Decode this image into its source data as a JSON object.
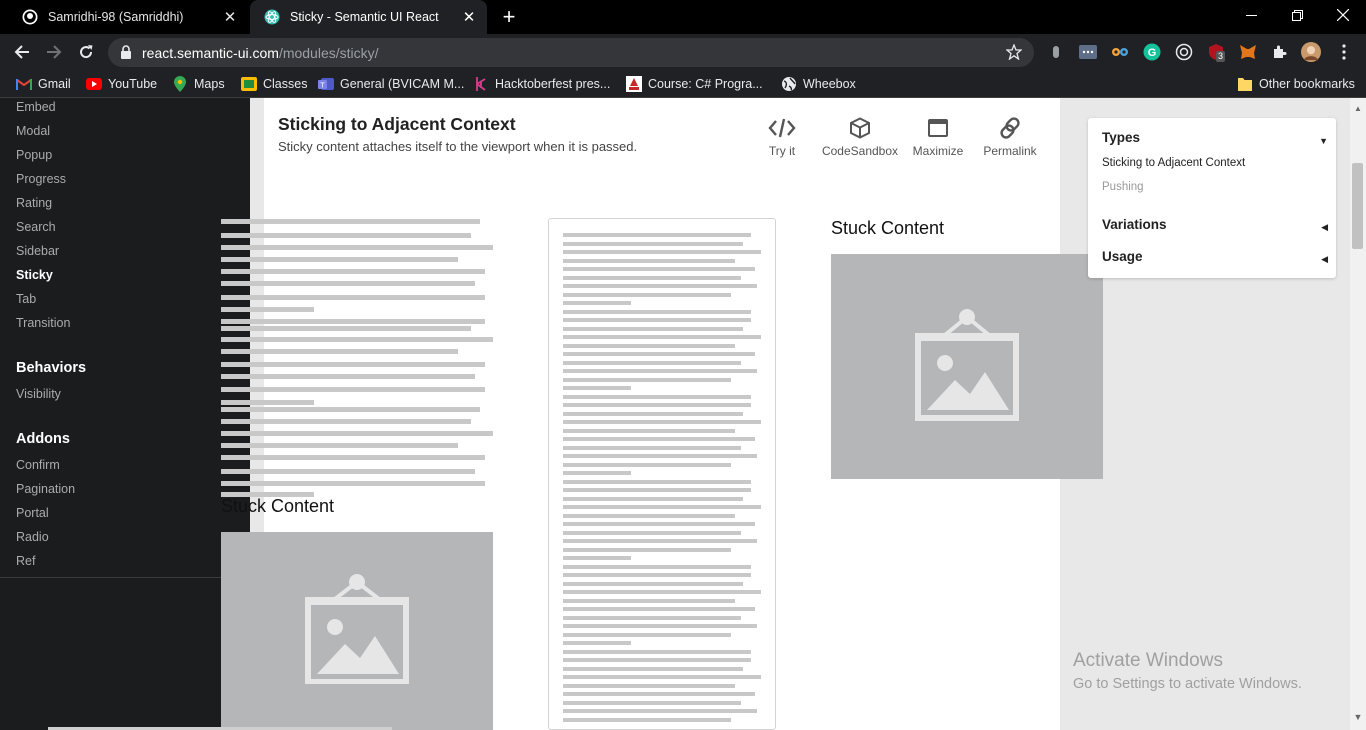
{
  "browser": {
    "tabs": [
      {
        "title": "Samridhi-98 (Samriddhi)",
        "active": false
      },
      {
        "title": "Sticky - Semantic UI React",
        "active": true
      }
    ],
    "url": {
      "host": "react.semantic-ui.com",
      "path": "/modules/sticky/"
    },
    "bookmarks": [
      {
        "label": "Gmail",
        "icon": "gmail-icon"
      },
      {
        "label": "YouTube",
        "icon": "youtube-icon"
      },
      {
        "label": "Maps",
        "icon": "maps-icon"
      },
      {
        "label": "Classes",
        "icon": "classes-icon"
      },
      {
        "label": "General (BVICAM M...",
        "icon": "teams-icon"
      },
      {
        "label": "Hacktoberfest pres...",
        "icon": "hacktoberfest-icon"
      },
      {
        "label": "Course: C# Progra...",
        "icon": "course-icon"
      },
      {
        "label": "Wheebox",
        "icon": "globe-icon"
      }
    ],
    "other_bookmarks": "Other bookmarks",
    "extension_badge": "3"
  },
  "sidebar": {
    "modules": [
      "Embed",
      "Modal",
      "Popup",
      "Progress",
      "Rating",
      "Search",
      "Sidebar",
      "Sticky",
      "Tab",
      "Transition"
    ],
    "active": "Sticky",
    "behaviors_heading": "Behaviors",
    "behaviors": [
      "Visibility"
    ],
    "addons_heading": "Addons",
    "addons": [
      "Confirm",
      "Pagination",
      "Portal",
      "Radio",
      "Ref"
    ]
  },
  "example": {
    "title": "Sticking to Adjacent Context",
    "description": "Sticky content attaches itself to the viewport when it is passed.",
    "actions": [
      {
        "label": "Try it",
        "icon": "code-icon"
      },
      {
        "label": "CodeSandbox",
        "icon": "cube-icon"
      },
      {
        "label": "Maximize",
        "icon": "maximize-icon"
      },
      {
        "label": "Permalink",
        "icon": "link-icon"
      }
    ],
    "stuck_left": "Stuck Content",
    "stuck_right": "Stuck Content"
  },
  "right_menu": {
    "types_heading": "Types",
    "types_items": [
      "Sticking to Adjacent Context",
      "Pushing"
    ],
    "variations_heading": "Variations",
    "usage_heading": "Usage"
  },
  "watermark": {
    "line1": "Activate Windows",
    "line2": "Go to Settings to activate Windows."
  },
  "colors": {
    "sidebar_bg": "#1b1c1d",
    "placeholder_grey": "#b5b6b8",
    "text_line_grey": "#c8c8c8"
  }
}
